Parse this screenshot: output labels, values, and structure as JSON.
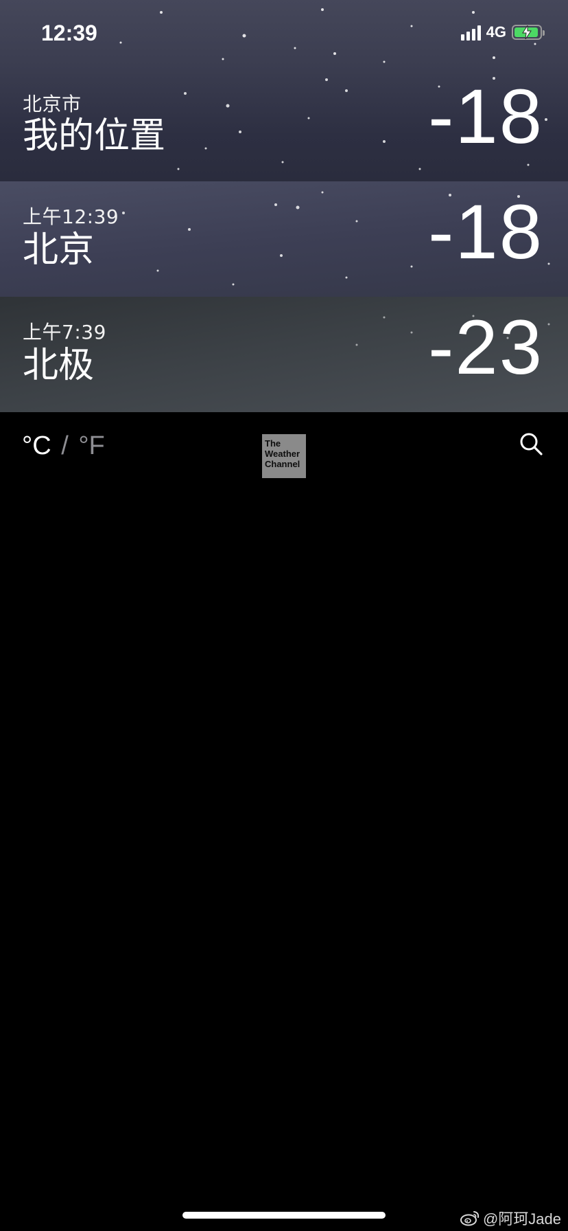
{
  "status_bar": {
    "time": "12:39",
    "network": "4G",
    "battery_level": 0.85,
    "battery_color": "#4cd964",
    "charging": true
  },
  "cities": [
    {
      "subtitle": "北京市",
      "name": "我的位置",
      "temperature": "-18"
    },
    {
      "subtitle": "上午12:39",
      "name": "北京",
      "temperature": "-18"
    },
    {
      "subtitle": "上午7:39",
      "name": "北极",
      "temperature": "-23"
    }
  ],
  "toolbar": {
    "unit_celsius": "°C",
    "unit_separator": "/",
    "unit_fahrenheit": "°F",
    "active_unit": "°C",
    "logo_lines": [
      "The",
      "Weather",
      "Channel"
    ],
    "search_icon": "magnifying-glass-icon"
  },
  "watermark": {
    "text": "@阿珂Jade",
    "icon": "weibo-icon"
  },
  "colors": {
    "background": "#000000",
    "inactive_text": "#8e8e93",
    "logo_bg": "#8a8a8a"
  }
}
